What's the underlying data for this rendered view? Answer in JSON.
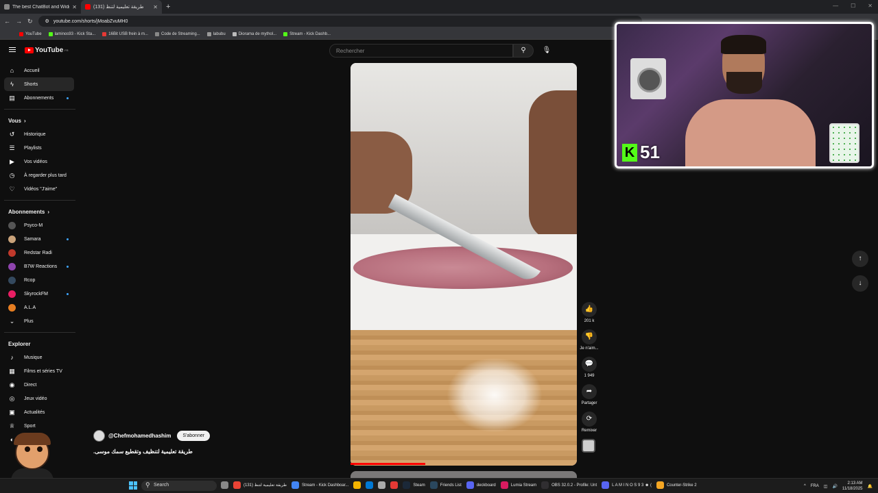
{
  "browser": {
    "tabs": [
      {
        "label": "The best ChatBot and Widgets",
        "active": false
      },
      {
        "label": "طريقة تعليمية لتنظ (131)",
        "active": true
      }
    ],
    "url": "youtube.com/shorts/jMoabZvuMH0",
    "bookmarks": [
      "YouTube",
      "laminos93 - Kick Sta...",
      "16Bit USB frein à m...",
      "Code de Streaming...",
      "labubu",
      "Diorama de mythol...",
      "Stream - Kick Dashb..."
    ]
  },
  "header": {
    "logo_text": "YouTube",
    "country": "FR",
    "search_placeholder": "Rechercher"
  },
  "sidebar": {
    "main": [
      {
        "label": "Accueil",
        "icon": "home-icon",
        "glyph": "⌂"
      },
      {
        "label": "Shorts",
        "icon": "shorts-icon",
        "glyph": "ϟ",
        "active": true
      },
      {
        "label": "Abonnements",
        "icon": "subscriptions-icon",
        "glyph": "▤",
        "dot": true
      }
    ],
    "you_header": "Vous",
    "you": [
      {
        "label": "Historique",
        "icon": "history-icon",
        "glyph": "↺"
      },
      {
        "label": "Playlists",
        "icon": "playlists-icon",
        "glyph": "☰"
      },
      {
        "label": "Vos vidéos",
        "icon": "your-videos-icon",
        "glyph": "▶"
      },
      {
        "label": "À regarder plus tard",
        "icon": "watch-later-icon",
        "glyph": "◷"
      },
      {
        "label": "Vidéos \"J'aime\"",
        "icon": "liked-icon",
        "glyph": "♡"
      }
    ],
    "subs_header": "Abonnements",
    "subs": [
      {
        "label": "Psyco-M",
        "color": "#555555",
        "dot": false
      },
      {
        "label": "Samara",
        "color": "#c9a27a",
        "dot": true
      },
      {
        "label": "Redstar Radi",
        "color": "#c0392b",
        "dot": false
      },
      {
        "label": "B7W Reactions",
        "color": "#8e44ad",
        "dot": true
      },
      {
        "label": "Rcop",
        "color": "#34495e",
        "dot": false
      },
      {
        "label": "SkyrockFM",
        "color": "#e91e63",
        "dot": true
      },
      {
        "label": "A.L.A",
        "color": "#e67e22",
        "dot": false
      }
    ],
    "more_label": "Plus",
    "explore_header": "Explorer",
    "explore": [
      {
        "label": "Musique",
        "icon": "music-icon",
        "glyph": "♪"
      },
      {
        "label": "Films et séries TV",
        "icon": "films-icon",
        "glyph": "▦"
      },
      {
        "label": "Direct",
        "icon": "live-icon",
        "glyph": "◉"
      },
      {
        "label": "Jeux vidéo",
        "icon": "gaming-icon",
        "glyph": "◎"
      },
      {
        "label": "Actualités",
        "icon": "news-icon",
        "glyph": "▣"
      },
      {
        "label": "Sport",
        "icon": "sport-icon",
        "glyph": "♕"
      },
      {
        "label": "...tures",
        "icon": "courses-icon",
        "glyph": "◐"
      }
    ]
  },
  "short": {
    "channel": "@Chefmohamedhashim",
    "subscribe_label": "S'abonner",
    "title": "طريقة تعليمية لتنظيف وتقطيع سمك موسى.",
    "progress": 0.33
  },
  "actions": [
    {
      "name": "like-button",
      "glyph": "👍",
      "label": "201 k"
    },
    {
      "name": "dislike-button",
      "glyph": "👎",
      "label": "Je n'aim..."
    },
    {
      "name": "comments-button",
      "glyph": "💬",
      "label": "1 949"
    },
    {
      "name": "share-button",
      "glyph": "➦",
      "label": "Partager"
    },
    {
      "name": "remix-button",
      "glyph": "⟳",
      "label": "Remixer"
    }
  ],
  "overlay": {
    "kick_count": "51"
  },
  "taskbar": {
    "search_label": "Search",
    "items": [
      {
        "label": "",
        "color": "#888888"
      },
      {
        "label": "طريقة تعليمية لتنظ (131)",
        "color": "#ea4335"
      },
      {
        "label": "Stream - Kick Dashboar...",
        "color": "#4285f4"
      },
      {
        "label": "",
        "color": "#f4b400"
      },
      {
        "label": "",
        "color": "#0078d4"
      },
      {
        "label": "",
        "color": "#aaaaaa"
      },
      {
        "label": "",
        "color": "#e53935"
      },
      {
        "label": "Steam",
        "color": "#1b2838"
      },
      {
        "label": "Friends List",
        "color": "#2a475e"
      },
      {
        "label": "deckboard",
        "color": "#5865f2"
      },
      {
        "label": "Lumia Stream",
        "color": "#d81b60"
      },
      {
        "label": "OBS 32.0.2 - Profile: Unt",
        "color": "#302e31"
      },
      {
        "label": "L A M I N O S 9 3 ☻ (",
        "color": "#5865f2"
      },
      {
        "label": "Counter-Strike 2",
        "color": "#f5a623"
      }
    ],
    "lang": "FRA",
    "time": "2:13 AM",
    "date": "11/18/2025"
  }
}
